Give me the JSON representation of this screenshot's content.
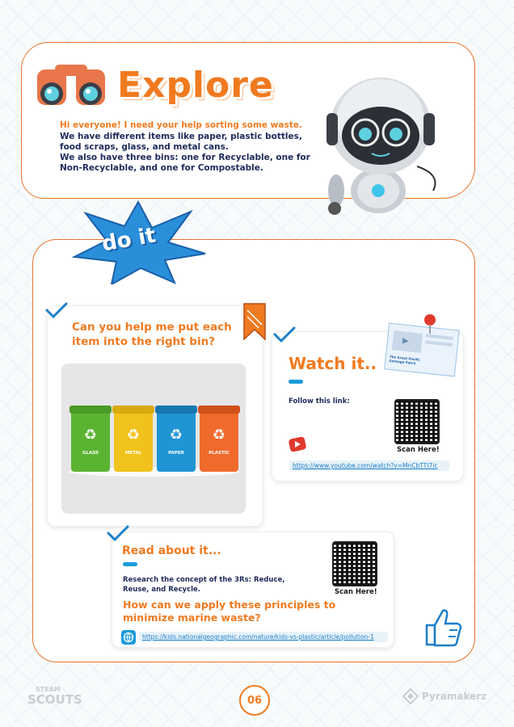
{
  "explore": {
    "title": "Explore",
    "highlight": "Hi everyone! I need your help sorting some waste.",
    "line1": "We have different items like paper, plastic bottles,",
    "line2": "food scraps, glass, and metal cans.",
    "line3": "We also have three bins: one for Recyclable, one for",
    "line4": "Non-Recyclable, and one for Compostable."
  },
  "doit": {
    "label": "do it"
  },
  "task": {
    "question": "Can you help me put each item into the right bin?",
    "bins": [
      "GLASS",
      "METAL",
      "PAPER",
      "PLASTIC"
    ]
  },
  "watch": {
    "title": "Watch it..",
    "follow": "Follow this link:",
    "scan": "Scan Here!",
    "link": "https://www.youtube.com/watch?v=MnCbTTI7ic",
    "thumb_text": "The Great Pacific Garbage Patch"
  },
  "read": {
    "title": "Read about it...",
    "body": "Research the concept of the 3Rs: Reduce, Reuse, and Recycle.",
    "question": "How can we apply these principles to minimize marine waste?",
    "scan": "Scan Here!",
    "link": "https://kids.nationalgeographic.com/nature/kids-vs-plastic/article/pollution-1"
  },
  "footer": {
    "page_number": "06",
    "brand_left_top": "STEAM",
    "brand_left_bottom": "SCOUTS",
    "brand_right": "Pyramakerz"
  },
  "colors": {
    "orange": "#f07a20",
    "navy": "#1f2a5a",
    "blue": "#1c9bd8",
    "bin_green": "#5bb431",
    "bin_yellow": "#f1c21b",
    "bin_blue": "#1f95d4",
    "bin_orange": "#f06a2c"
  }
}
